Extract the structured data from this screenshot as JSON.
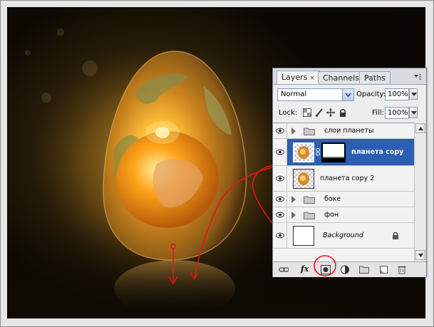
{
  "panel": {
    "tabs": [
      {
        "label": "Layers",
        "close": "×",
        "active": true
      },
      {
        "label": "Channels",
        "active": false
      },
      {
        "label": "Paths",
        "active": false
      }
    ],
    "blend_mode": "Normal",
    "opacity_label": "Opacity:",
    "opacity_value": "100%",
    "lock_label": "Lock:",
    "fill_label": "Fill:",
    "fill_value": "100%",
    "layers": [
      {
        "name": "слои планеты",
        "type": "group",
        "visible": true,
        "selected": false
      },
      {
        "name": "планета copy",
        "type": "masked-layer",
        "visible": true,
        "selected": true
      },
      {
        "name": "планета copy 2",
        "type": "layer",
        "visible": true,
        "selected": false
      },
      {
        "name": "боке",
        "type": "group",
        "visible": true,
        "selected": false
      },
      {
        "name": "фон",
        "type": "group",
        "visible": true,
        "selected": false
      },
      {
        "name": "Background",
        "type": "background",
        "visible": true,
        "selected": false,
        "locked": true
      }
    ],
    "bottom_icons": [
      "link-icon",
      "fx-icon",
      "add-mask-icon",
      "adjustment-icon",
      "new-group-icon",
      "new-layer-icon",
      "trash-icon"
    ],
    "fx_label": "fx"
  },
  "colors": {
    "selection": "#2c5fb3",
    "annotation": "#e8141a",
    "glow": "#ffc845"
  }
}
